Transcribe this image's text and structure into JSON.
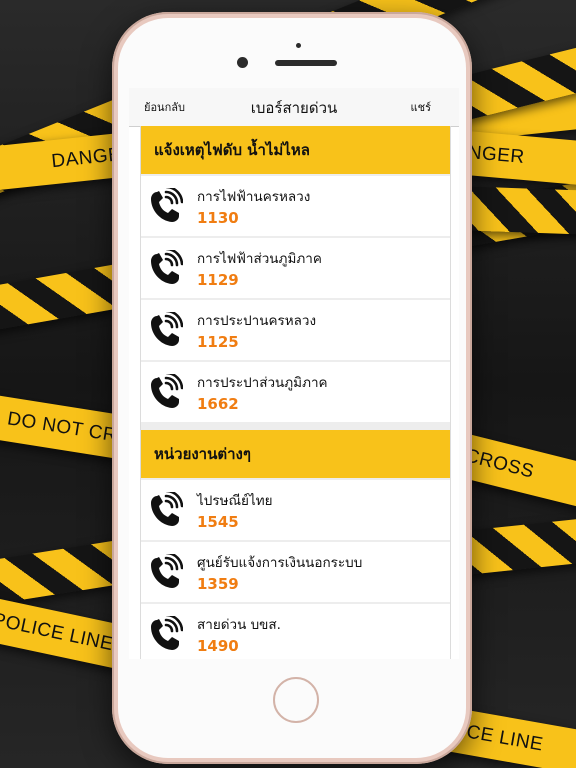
{
  "background": {
    "tapes": [
      {
        "text": "DANGER"
      },
      {
        "text": "DANGER"
      },
      {
        "text": "DO NOT CROSS"
      },
      {
        "text": "DO NOT CROSS"
      },
      {
        "text": "POLICE LINE"
      },
      {
        "text": "POLICE LINE"
      }
    ]
  },
  "navbar": {
    "back_label": "ย้อนกลับ",
    "title": "เบอร์สายด่วน",
    "share_label": "แชร์"
  },
  "sections": [
    {
      "title": "แจ้งเหตุไฟดับ น้ำไม่ไหล",
      "items": [
        {
          "name": "การไฟฟ้านครหลวง",
          "number": "1130"
        },
        {
          "name": "การไฟฟ้าส่วนภูมิภาค",
          "number": "1129"
        },
        {
          "name": "การประปานครหลวง",
          "number": "1125"
        },
        {
          "name": "การประปาส่วนภูมิภาค",
          "number": "1662"
        }
      ]
    },
    {
      "title": "หน่วยงานต่างๆ",
      "items": [
        {
          "name": "ไปรษณีย์ไทย",
          "number": "1545"
        },
        {
          "name": "ศูนย์รับแจ้งการเงินนอกระบบ",
          "number": "1359"
        },
        {
          "name": "สายด่วน บขส.",
          "number": "1490"
        }
      ]
    }
  ],
  "colors": {
    "accent_yellow": "#f8c21a",
    "number_orange": "#f07d12",
    "phone_body": "#e8c9bf"
  },
  "icons": {
    "row_icon": "phone-call-icon"
  }
}
